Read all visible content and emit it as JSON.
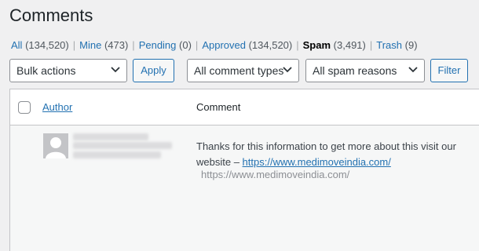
{
  "header": {
    "title": "Comments"
  },
  "filters": [
    {
      "label": "All",
      "count": "(134,520)",
      "current": false
    },
    {
      "label": "Mine",
      "count": "(473)",
      "current": false
    },
    {
      "label": "Pending",
      "count": "(0)",
      "current": false
    },
    {
      "label": "Approved",
      "count": "(134,520)",
      "current": false
    },
    {
      "label": "Spam",
      "count": "(3,491)",
      "current": true
    },
    {
      "label": "Trash",
      "count": "(9)",
      "current": false
    }
  ],
  "toolbar": {
    "bulk_actions": "Bulk actions",
    "apply": "Apply",
    "comment_types": "All comment types",
    "spam_reasons": "All spam reasons",
    "filter": "Filter"
  },
  "table": {
    "headers": {
      "author": "Author",
      "comment": "Comment"
    },
    "rows": [
      {
        "comment_text": "Thanks for this information to get more about this visit our website – ",
        "comment_link": "https://www.medimoveindia.com/",
        "author_url": "https://www.medimoveindia.com/"
      }
    ]
  },
  "colors": {
    "accent": "#2271b1",
    "background": "#f0f0f1",
    "border": "#c3c4c7"
  }
}
